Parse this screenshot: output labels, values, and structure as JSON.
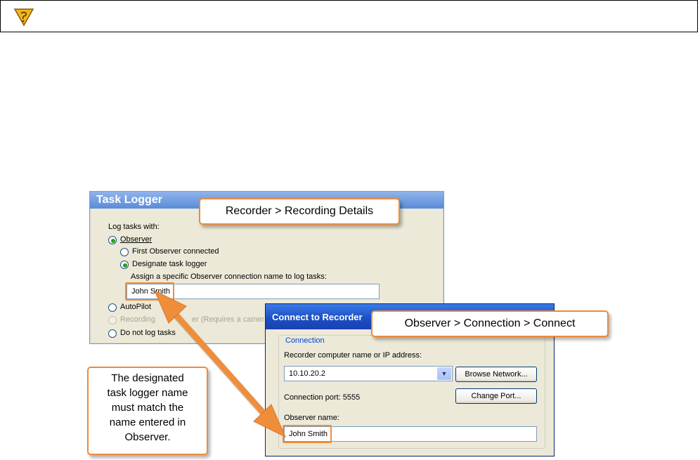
{
  "task_logger": {
    "title": "Task Logger",
    "log_tasks_with": "Log tasks with:",
    "observer": "Observer",
    "first_observer": "First Observer connected",
    "designate_logger": "Designate task logger",
    "assign_label": "Assign a specific Observer connection name to log tasks:",
    "name_value": "John Smith",
    "autopilot": "AutoPilot",
    "recording_hidden_start": "Recording",
    "recording_hidden_end": "er (Requires a camera as",
    "do_not_log": "Do not log tasks"
  },
  "callout_recorder": "Recorder > Recording Details",
  "connect_dialog": {
    "title": "Connect to Recorder",
    "group_label": "Connection",
    "recorder_label": "Recorder computer name or IP address:",
    "address_value": "10.10.20.2",
    "browse_button": "Browse Network...",
    "port_label": "Connection port: 5555",
    "change_port_button": "Change Port...",
    "observer_name_label": "Observer name:",
    "observer_name_value": "John Smith"
  },
  "callout_observer": "Observer > Connection > Connect",
  "callout_note": [
    "The designated",
    "task logger name",
    "must match the",
    "name entered in",
    "Observer."
  ],
  "colors": {
    "accent": "#ec8b3c",
    "title_blue": "#1c4fc6"
  },
  "icons": {
    "tip": "tip-icon"
  }
}
